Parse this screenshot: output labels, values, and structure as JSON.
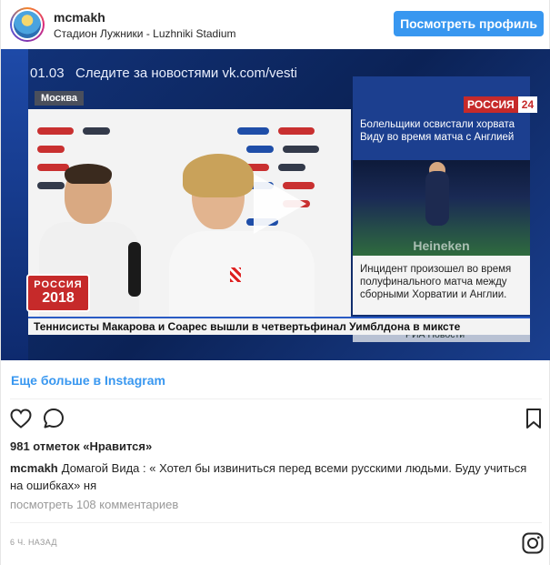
{
  "header": {
    "username": "mcmakh",
    "location": "Стадион Лужники - Luzhniki Stadium",
    "profile_button": "Посмотреть профиль"
  },
  "video": {
    "time": "01.03",
    "top_ticker": "Следите за новостями vk.com/vesti",
    "city": "Москва",
    "badge_line1": "РОССИЯ",
    "badge_line2": "2018",
    "channel_name": "РОССИЯ",
    "channel_number": "24",
    "panel_headline": "Болельщики освистали хорвата Виду во время матча с Англией",
    "panel_photo_text": "Heineken",
    "panel_text": "Инцидент произошел во время полуфинального матча между сборными Хорватии и Англии.",
    "panel_source": "РИА Новости",
    "bottom_ticker": "Теннисисты Макарова и Соарес вышли в четвертьфинал Уимблдона в миксте"
  },
  "more_link": "Еще больше в Instagram",
  "actions": {
    "like_icon": "heart-icon",
    "comment_icon": "comment-icon",
    "save_icon": "bookmark-icon"
  },
  "likes": "981 отметок «Нравится»",
  "caption": {
    "user": "mcmakh",
    "text": "Домагой Вида : « Хотел бы извиниться перед всеми русскими людьми. Буду учиться на ошибках» ня"
  },
  "comments_link": "посмотреть 108 комментариев",
  "timestamp": "6 Ч. НАЗАД",
  "footer": {
    "instagram_icon": "instagram-icon"
  },
  "colors": {
    "accent": "#3897f0",
    "text": "#262626",
    "muted": "#999999",
    "channel_red": "#c62a2a"
  }
}
